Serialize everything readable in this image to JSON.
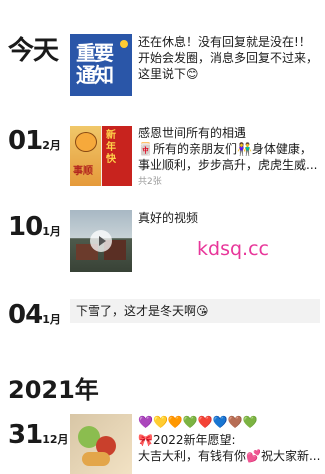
{
  "entries": [
    {
      "date_label": "今天",
      "text": "还在休息！没有回复就是没在!！开始会发圈，消息多回复不过来，这里说下😊",
      "thumb_text": [
        "重要",
        "通知"
      ]
    },
    {
      "day": "01",
      "month": "2月",
      "text": "感恩世间所有的相遇\n🀄所有的亲朋友们👫身体健康，事业顺利，步步高升，虎虎生威...",
      "count": "共2张",
      "thumb_text": [
        "事顺",
        "新",
        "年",
        "快"
      ]
    },
    {
      "day": "10",
      "month": "1月",
      "text": "真好的视频"
    },
    {
      "day": "04",
      "month": "1月",
      "text": "下雪了，这才是冬天啊😘"
    }
  ],
  "year_header": "2021年",
  "last_entry": {
    "day": "31",
    "month": "12月",
    "emoji_line": "💜💛🧡💚❤️💙🤎💚",
    "text": "🎀2022新年愿望:\n大吉大利，有钱有你💕祝大家新..."
  },
  "watermark": "kdsq.cc",
  "colors": {
    "notice_bg": "#2a56a8",
    "watermark": "#e8369a"
  }
}
